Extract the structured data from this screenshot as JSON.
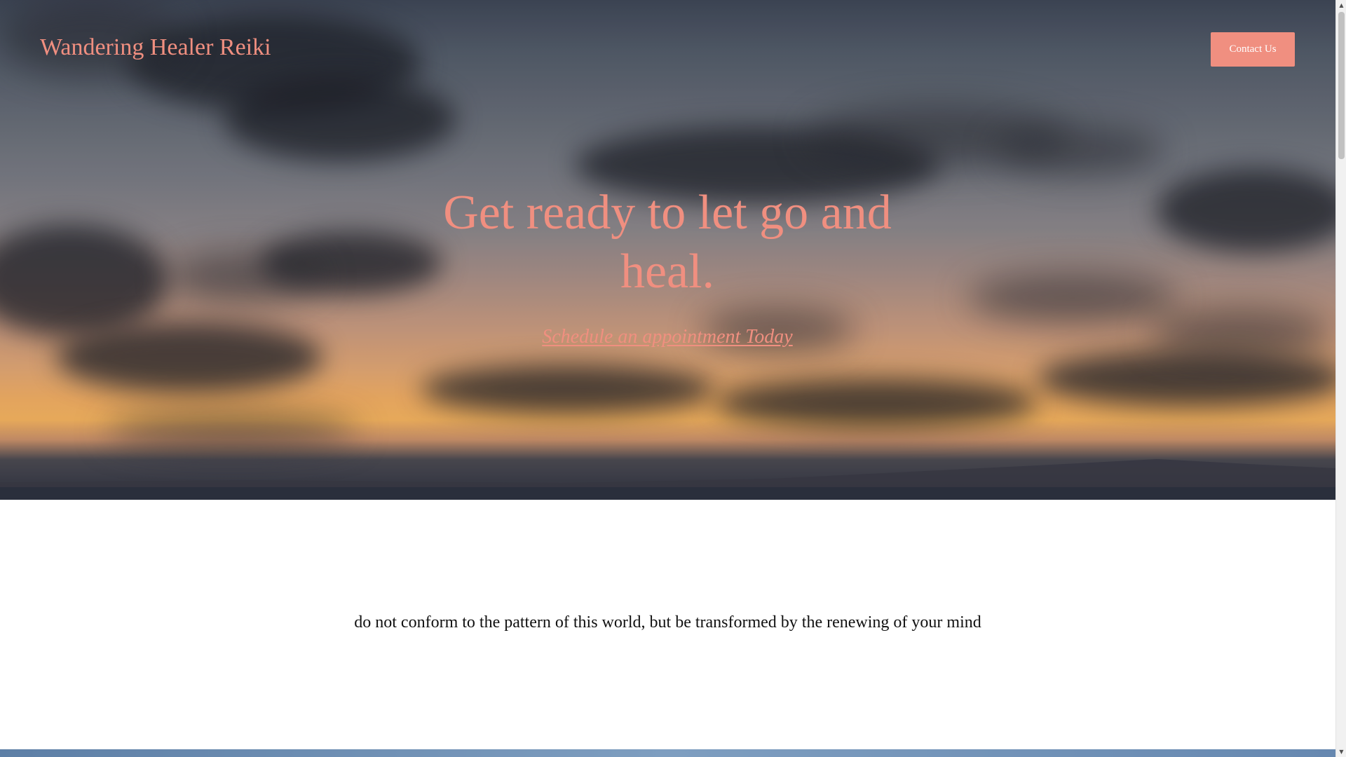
{
  "header": {
    "site_title": "Wandering Healer Reiki",
    "contact_label": "Contact Us"
  },
  "hero": {
    "headline": "Get ready to let go and heal.",
    "cta_label": "Schedule an appointment Today",
    "background": "sunset-over-ocean-image"
  },
  "quote": {
    "text": "do not conform to the pattern of this world, but be transformed by the renewing of your mind"
  },
  "colors": {
    "accent": "#f08f80",
    "text": "#111111",
    "background": "#ffffff"
  },
  "icons": {
    "scroll_up": "scroll-up-arrow-icon",
    "scroll_down": "scroll-down-arrow-icon"
  }
}
